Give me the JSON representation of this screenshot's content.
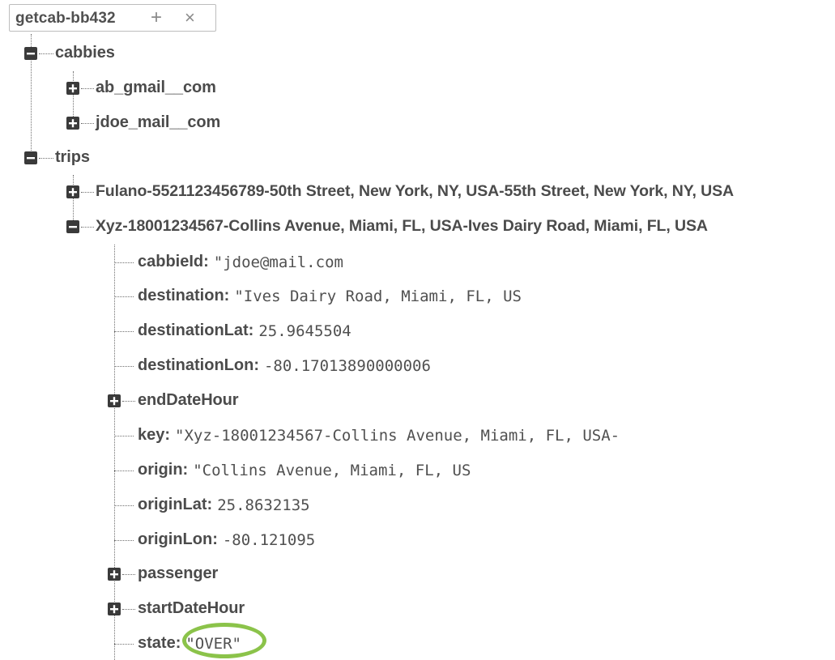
{
  "database": {
    "name": "getcab-bb432",
    "add_glyph": "+",
    "close_glyph": "×"
  },
  "tree": {
    "cabbies": {
      "key": "cabbies",
      "children": [
        "ab_gmail__com",
        "jdoe_mail__com"
      ]
    },
    "trips": {
      "key": "trips",
      "trip1": "Fulano-5521123456789-50th Street, New York, NY, USA-55th Street, New York, NY, USA",
      "trip2": "Xyz-18001234567-Collins Avenue, Miami, FL, USA-Ives Dairy Road, Miami, FL, USA",
      "fields": {
        "cabbieId": {
          "key": "cabbieId:",
          "value": "\"jdoe@mail.com"
        },
        "destination": {
          "key": "destination:",
          "value": "\"Ives Dairy Road, Miami, FL, US"
        },
        "destinationLat": {
          "key": "destinationLat:",
          "value": "25.9645504"
        },
        "destinationLon": {
          "key": "destinationLon:",
          "value": "-80.17013890000006"
        },
        "endDateHour": {
          "key": "endDateHour"
        },
        "key": {
          "key": "key:",
          "value": "\"Xyz-18001234567-Collins Avenue, Miami, FL, USA-"
        },
        "origin": {
          "key": "origin:",
          "value": "\"Collins Avenue, Miami, FL, US"
        },
        "originLat": {
          "key": "originLat:",
          "value": "25.8632135"
        },
        "originLon": {
          "key": "originLon:",
          "value": "-80.121095"
        },
        "passenger": {
          "key": "passenger"
        },
        "startDateHour": {
          "key": "startDateHour"
        },
        "state": {
          "key": "state:",
          "value": "\"OVER\""
        }
      }
    }
  },
  "colors": {
    "text": "#4b4b4b",
    "tree_line": "#707070",
    "toggle_fill": "#3a3a3a",
    "highlight": "#8bc34a"
  },
  "icons": {
    "expand": "plus-square-icon",
    "collapse": "minus-square-icon"
  }
}
